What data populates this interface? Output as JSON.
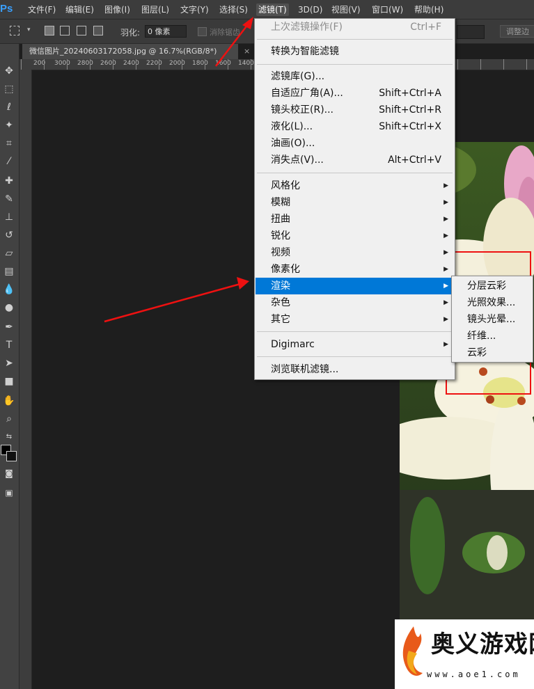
{
  "app": {
    "logo": "Ps",
    "menus": [
      "文件(F)",
      "编辑(E)",
      "图像(I)",
      "图层(L)",
      "文字(Y)",
      "选择(S)",
      "滤镜(T)",
      "3D(D)",
      "视图(V)",
      "窗口(W)",
      "帮助(H)"
    ]
  },
  "options": {
    "feather_label": "羽化:",
    "feather_value": "0 像素",
    "antialias_label": "消除锯齿",
    "refine_label": "调整边"
  },
  "document": {
    "tab_title": "微信图片_20240603172058.jpg @ 16.7%(RGB/8*)",
    "close": "×"
  },
  "ruler_h_labels": [
    "200",
    "3000",
    "2800",
    "2600",
    "2400",
    "2200",
    "2000",
    "1800",
    "1600",
    "1400"
  ],
  "filter_menu": {
    "items": [
      {
        "label": "上次滤镜操作(F)",
        "shortcut": "Ctrl+F",
        "disabled": true
      },
      {
        "label": "转换为智能滤镜",
        "shortcut": ""
      },
      {
        "label": "滤镜库(G)...",
        "shortcut": ""
      },
      {
        "label": "自适应广角(A)...",
        "shortcut": "Shift+Ctrl+A"
      },
      {
        "label": "镜头校正(R)...",
        "shortcut": "Shift+Ctrl+R"
      },
      {
        "label": "液化(L)...",
        "shortcut": "Shift+Ctrl+X"
      },
      {
        "label": "油画(O)...",
        "shortcut": ""
      },
      {
        "label": "消失点(V)...",
        "shortcut": "Alt+Ctrl+V"
      },
      {
        "label": "风格化",
        "submenu": true
      },
      {
        "label": "模糊",
        "submenu": true
      },
      {
        "label": "扭曲",
        "submenu": true
      },
      {
        "label": "锐化",
        "submenu": true
      },
      {
        "label": "视频",
        "submenu": true
      },
      {
        "label": "像素化",
        "submenu": true
      },
      {
        "label": "渲染",
        "submenu": true,
        "highlighted": true
      },
      {
        "label": "杂色",
        "submenu": true
      },
      {
        "label": "其它",
        "submenu": true
      },
      {
        "label": "Digimarc",
        "submenu": true
      },
      {
        "label": "浏览联机滤镜...",
        "shortcut": ""
      }
    ]
  },
  "render_submenu": {
    "items": [
      "分层云彩",
      "光照效果...",
      "镜头光晕...",
      "纤维...",
      "云彩"
    ]
  },
  "colors": {
    "highlight": "#0078d7",
    "annotation_red": "#e11111"
  },
  "watermark": {
    "text": "奥义游戏网",
    "url": "www.aoe1.com"
  }
}
